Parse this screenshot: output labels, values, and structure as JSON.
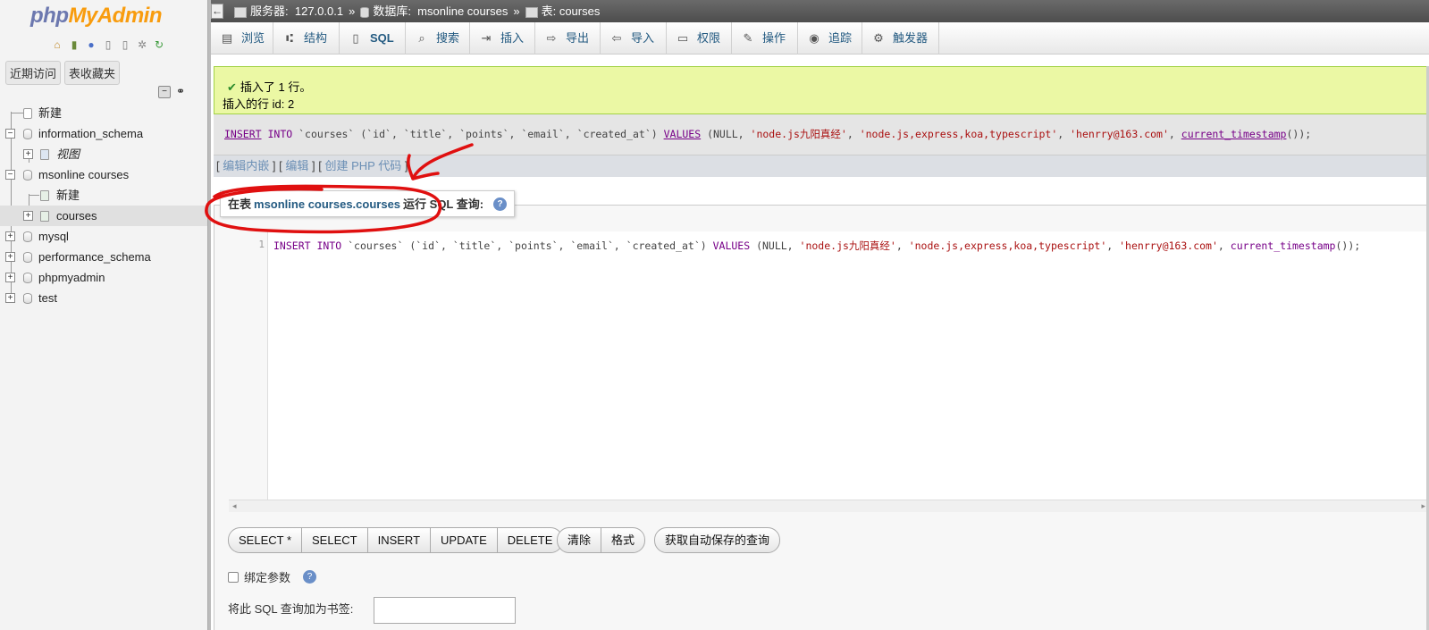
{
  "left": {
    "logo_php": "php",
    "logo_myadmin": "MyAdmin",
    "nav_icons": [
      "home-icon",
      "exit-icon",
      "help-icon",
      "docs-icon",
      "copy-icon",
      "settings-icon",
      "reload-icon"
    ],
    "tab_recent": "近期访问",
    "tab_favorites": "表收藏夹",
    "tree": {
      "new": "新建",
      "information_schema": "information_schema",
      "views": "视图",
      "msonline_courses": "msonline courses",
      "new_table": "新建",
      "courses": "courses",
      "mysql": "mysql",
      "performance_schema": "performance_schema",
      "phpmyadmin": "phpmyadmin",
      "test": "test"
    }
  },
  "breadcrumb": {
    "server_label": "服务器:",
    "server_value": "127.0.0.1",
    "db_label": "数据库:",
    "db_value": "msonline courses",
    "table_label": "表:",
    "table_value": "courses",
    "sep": "»"
  },
  "tabs": [
    {
      "label": "浏览",
      "icon": "browse-icon"
    },
    {
      "label": "结构",
      "icon": "structure-icon"
    },
    {
      "label": "SQL",
      "icon": "sql-icon"
    },
    {
      "label": "搜索",
      "icon": "search-icon"
    },
    {
      "label": "插入",
      "icon": "insert-icon"
    },
    {
      "label": "导出",
      "icon": "export-icon"
    },
    {
      "label": "导入",
      "icon": "import-icon"
    },
    {
      "label": "权限",
      "icon": "privileges-icon"
    },
    {
      "label": "操作",
      "icon": "operations-icon"
    },
    {
      "label": "追踪",
      "icon": "tracking-icon"
    },
    {
      "label": "触发器",
      "icon": "triggers-icon"
    }
  ],
  "success": {
    "line1": "插入了 1 行。",
    "line2": "插入的行 id: 2"
  },
  "sql_display": {
    "p1": "INSERT",
    "p2": " INTO ",
    "p3": "`courses` (`id`, `title`, `points`, `email`, `created_at`) ",
    "p4": "VALUES",
    "p5": " (NULL, ",
    "p6": "'node.js九阳真经'",
    "p7": ", ",
    "p8": "'node.js,express,koa,typescript'",
    "p9": ", ",
    "p10": "'henrry@163.com'",
    "p11": ", ",
    "p12": "current_timestamp",
    "p13": "());"
  },
  "links": {
    "open": "[",
    "edit_inline": "编辑内嵌",
    "sep1": "] [",
    "edit": "编辑",
    "sep2": "] [",
    "create_php": "创建 PHP 代码",
    "close": "]"
  },
  "query_box": {
    "prefix": "在表",
    "table": "msonline courses.courses",
    "suffix": "运行 SQL 查询:",
    "line_number": "1",
    "code": {
      "c1": "INSERT INTO ",
      "c2": "`courses` (`id`, `title`, `points`, `email`, `created_at`) ",
      "c3": "VALUES",
      "c4": " (NULL, ",
      "c5": "'node.js九阳真经'",
      "c6": ", ",
      "c7": "'node.js,express,koa,typescript'",
      "c8": ", ",
      "c9": "'henrry@163.com'",
      "c10": ", ",
      "c11": "current_timestamp",
      "c12": "());"
    }
  },
  "buttons": {
    "select_star": "SELECT *",
    "select": "SELECT",
    "insert": "INSERT",
    "update": "UPDATE",
    "delete": "DELETE",
    "clear": "清除",
    "format": "格式",
    "autosave": "获取自动保存的查询"
  },
  "bind_params": "绑定参数",
  "bookmark_label": "将此 SQL 查询加为书签:",
  "colors": {
    "annotation": "#e01010",
    "success_bg": "#ebf8a4",
    "link": "#235a81"
  }
}
